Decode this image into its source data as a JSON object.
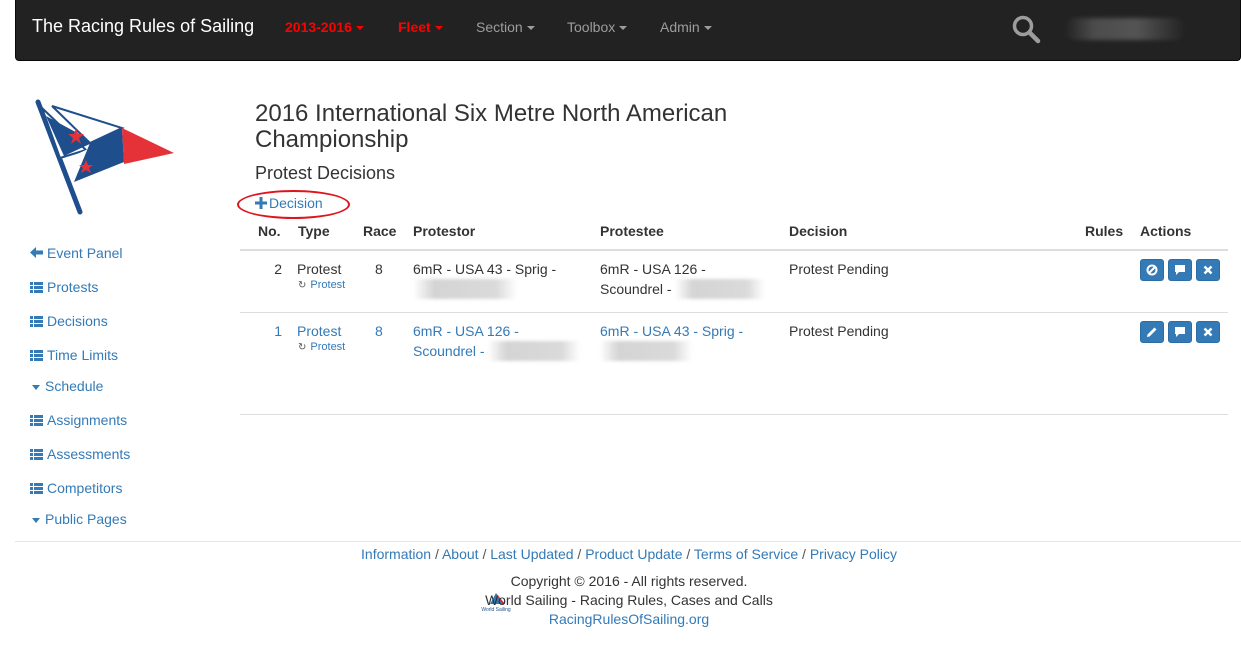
{
  "navbar": {
    "brand": "The Racing Rules of Sailing",
    "items": [
      {
        "label": "2013-2016",
        "highlight": true
      },
      {
        "label": "Fleet",
        "highlight": true
      },
      {
        "label": "Section",
        "highlight": false
      },
      {
        "label": "Toolbox",
        "highlight": false
      },
      {
        "label": "Admin",
        "highlight": false
      }
    ],
    "search_icon": "search-icon"
  },
  "sidebar": {
    "items": [
      {
        "label": "Event Panel",
        "icon": "arrow-left-icon"
      },
      {
        "label": "Protests",
        "icon": "list-icon"
      },
      {
        "label": "Decisions",
        "icon": "list-icon"
      },
      {
        "label": "Time Limits",
        "icon": "list-icon"
      },
      {
        "label": "Schedule",
        "icon": "caret-down-icon"
      },
      {
        "label": "Assignments",
        "icon": "list-icon"
      },
      {
        "label": "Assessments",
        "icon": "list-icon"
      },
      {
        "label": "Competitors",
        "icon": "list-icon"
      },
      {
        "label": "Public Pages",
        "icon": "caret-down-icon"
      }
    ]
  },
  "main": {
    "title": "2016 International Six Metre North American Championship",
    "subtitle": "Protest Decisions",
    "add_button": "Decision",
    "columns": [
      "No.",
      "Type",
      "Race",
      "Protestor",
      "Protestee",
      "Decision",
      "Rules",
      "Actions"
    ],
    "rows": [
      {
        "no": "2",
        "type": "Protest",
        "type_link": "Protest",
        "race": "8",
        "protestor_line1": "6mR - USA 43 - Sprig -",
        "protestee_line1": "6mR - USA 126 -",
        "protestee_line2": "Scoundrel -",
        "decision": "Protest Pending",
        "rules": "",
        "actions": [
          "ban-icon",
          "comment-icon",
          "remove-icon"
        ]
      },
      {
        "no": "1",
        "type": "Protest",
        "type_link": "Protest",
        "race": "8",
        "protestor_line1": "6mR - USA 126 -",
        "protestor_line2": "Scoundrel -",
        "protestee_line1": "6mR - USA 43 - Sprig -",
        "decision": "Protest Pending",
        "rules": "",
        "actions": [
          "pencil-icon",
          "comment-icon",
          "remove-icon"
        ]
      }
    ]
  },
  "footer": {
    "links": [
      "Information",
      "About",
      "Last Updated",
      "Product Update",
      "Terms of Service",
      "Privacy Policy"
    ],
    "copyright": "Copyright © 2016 - All rights reserved.",
    "org": "World Sailing - Racing Rules, Cases and Calls",
    "site": "RacingRulesOfSailing.org",
    "logo_text": "World Sailing"
  },
  "colors": {
    "navbar_bg": "#222222",
    "link": "#337ab7",
    "highlight": "#ff0000",
    "annotation": "#e0141e"
  }
}
